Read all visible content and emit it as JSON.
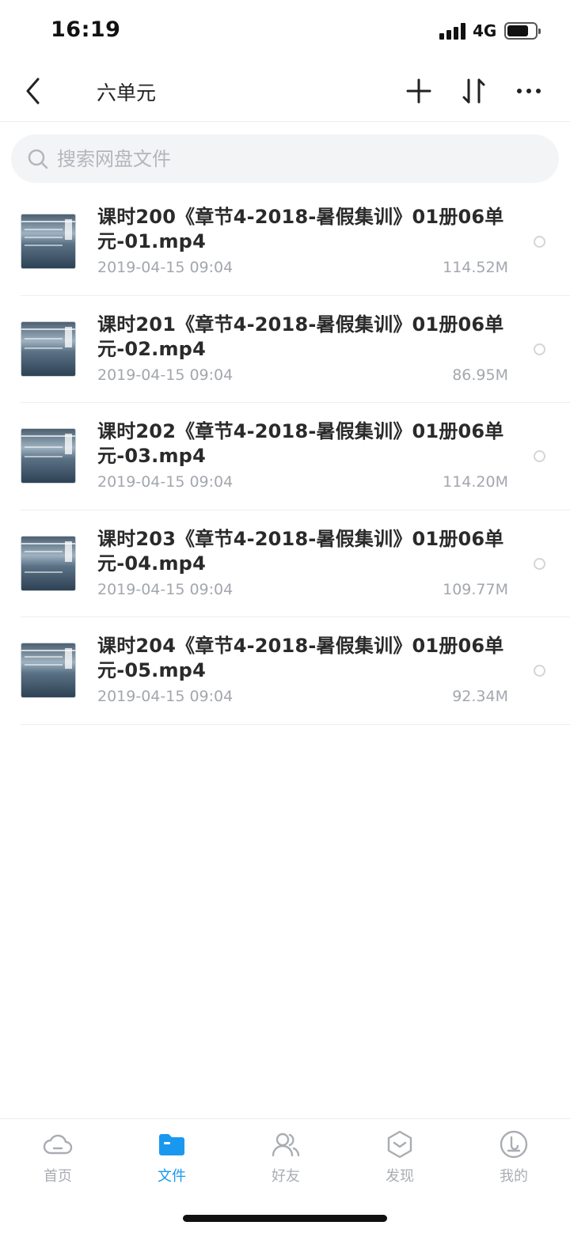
{
  "status": {
    "time": "16:19",
    "network": "4G",
    "battery_percent": 75
  },
  "nav": {
    "title": "六单元",
    "back_icon": "chevron-left-icon",
    "add_icon": "plus-icon",
    "sort_icon": "sort-icon",
    "more_icon": "more-dots-icon"
  },
  "search": {
    "placeholder": "搜索网盘文件",
    "value": ""
  },
  "files": [
    {
      "name": "课时200《章节4-2018-暑假集训》01册06单元-01.mp4",
      "date": "2019-04-15 09:04",
      "size": "114.52M"
    },
    {
      "name": "课时201《章节4-2018-暑假集训》01册06单元-02.mp4",
      "date": "2019-04-15 09:04",
      "size": "86.95M"
    },
    {
      "name": "课时202《章节4-2018-暑假集训》01册06单元-03.mp4",
      "date": "2019-04-15 09:04",
      "size": "114.20M"
    },
    {
      "name": "课时203《章节4-2018-暑假集训》01册06单元-04.mp4",
      "date": "2019-04-15 09:04",
      "size": "109.77M"
    },
    {
      "name": "课时204《章节4-2018-暑假集训》01册06单元-05.mp4",
      "date": "2019-04-15 09:04",
      "size": "92.34M"
    }
  ],
  "tabs": [
    {
      "label": "首页",
      "icon": "cloud-icon",
      "active": false
    },
    {
      "label": "文件",
      "icon": "folder-icon",
      "active": true
    },
    {
      "label": "好友",
      "icon": "friends-icon",
      "active": false
    },
    {
      "label": "发现",
      "icon": "discover-icon",
      "active": false
    },
    {
      "label": "我的",
      "icon": "profile-icon",
      "active": false
    }
  ],
  "colors": {
    "accent": "#1a98f0",
    "inactive": "#a9adb3",
    "text": "#2a2a2a",
    "meta": "#a3a7ad"
  }
}
